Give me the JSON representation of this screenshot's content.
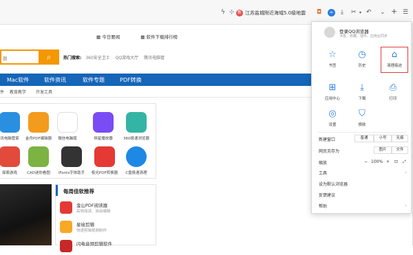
{
  "toolbar": {
    "news_badge": "新",
    "news_text": "江苏盐城附近海域5.0级地震",
    "icons": [
      "lightning-icon",
      "pin-icon",
      "game-icon",
      "infinity-icon",
      "download-icon",
      "cut-icon",
      "undo-icon",
      "chevron-down-icon",
      "plus-icon",
      "menu-icon"
    ]
  },
  "top_links": {
    "today_news": "今日要闻",
    "ranking": "软件下载排行榜"
  },
  "search": {
    "placeholder": "器",
    "button_icon": "search-icon",
    "hot_label": "热门搜索:",
    "hot_items": [
      "360安全卫士",
      "QQ游戏大厅",
      "腾讯电脑管"
    ]
  },
  "nav": {
    "items": [
      "Mac软件",
      "软件资讯",
      "软件专题",
      "PDF转换"
    ],
    "sub_items": [
      "件",
      "教育教学",
      "开发工具"
    ]
  },
  "apps": [
    {
      "label": "讯电脑管家",
      "color": "#2a8fe0"
    },
    {
      "label": "金舟PDF编辑器",
      "color": "#f39b1c"
    },
    {
      "label": "微信电脑版",
      "color": "#f0f0f0"
    },
    {
      "label": "恒星播放器",
      "color": "#7a4cf5"
    },
    {
      "label": "360极速浏览器",
      "color": "#34b4a4"
    },
    {
      "label": "探索游戏",
      "color": "#e24b3c"
    },
    {
      "label": "CAD迷你看图",
      "color": "#7cb342"
    },
    {
      "label": "iFonts字体助手",
      "color": "#333333"
    },
    {
      "label": "极光PDF转换器",
      "color": "#e53935"
    },
    {
      "label": "C盘极速清理",
      "color": "#1e88e5"
    }
  ],
  "weekly": {
    "title": "每周佳软推荐",
    "items": [
      {
        "title": "金山PDF阅读器",
        "desc": "高效阅读、自由编辑",
        "color": "#e53935"
      },
      {
        "title": "星绘剪辑",
        "desc": "快速剪辑视频制作",
        "color": "#f9a825"
      },
      {
        "title": "闪电音频剪辑软件",
        "desc": "",
        "color": "#c62828"
      }
    ]
  },
  "menu": {
    "login_title": "登录QQ浏览器",
    "login_desc": "书签、收藏、插件、应用云同步",
    "grid": [
      {
        "label": "书签",
        "icon": "star-icon",
        "glyph": "☆"
      },
      {
        "label": "历史",
        "icon": "clock-icon",
        "glyph": "◷"
      },
      {
        "label": "清理痕迹",
        "icon": "broom-icon",
        "glyph": "⌂"
      },
      {
        "label": "应用中心",
        "icon": "apps-icon",
        "glyph": "⊞"
      },
      {
        "label": "下载",
        "icon": "download-icon",
        "glyph": "⤓"
      },
      {
        "label": "打印",
        "icon": "printer-icon",
        "glyph": "⎙"
      },
      {
        "label": "设置",
        "icon": "settings-icon",
        "glyph": "◎"
      },
      {
        "label": "换肤",
        "icon": "shirt-icon",
        "glyph": "⛉"
      }
    ],
    "new_window": {
      "label": "新建窗口",
      "options": [
        "普通",
        "小号",
        "无痕"
      ]
    },
    "save_as": {
      "label": "网页另存为",
      "options": [
        "图片",
        "文件"
      ]
    },
    "zoom": {
      "label": "缩放",
      "minus": "−",
      "value": "100%",
      "plus": "+"
    },
    "tools": "工具",
    "default_browser": "设为默认浏览器",
    "feedback": "反馈建议",
    "help": "帮助"
  }
}
